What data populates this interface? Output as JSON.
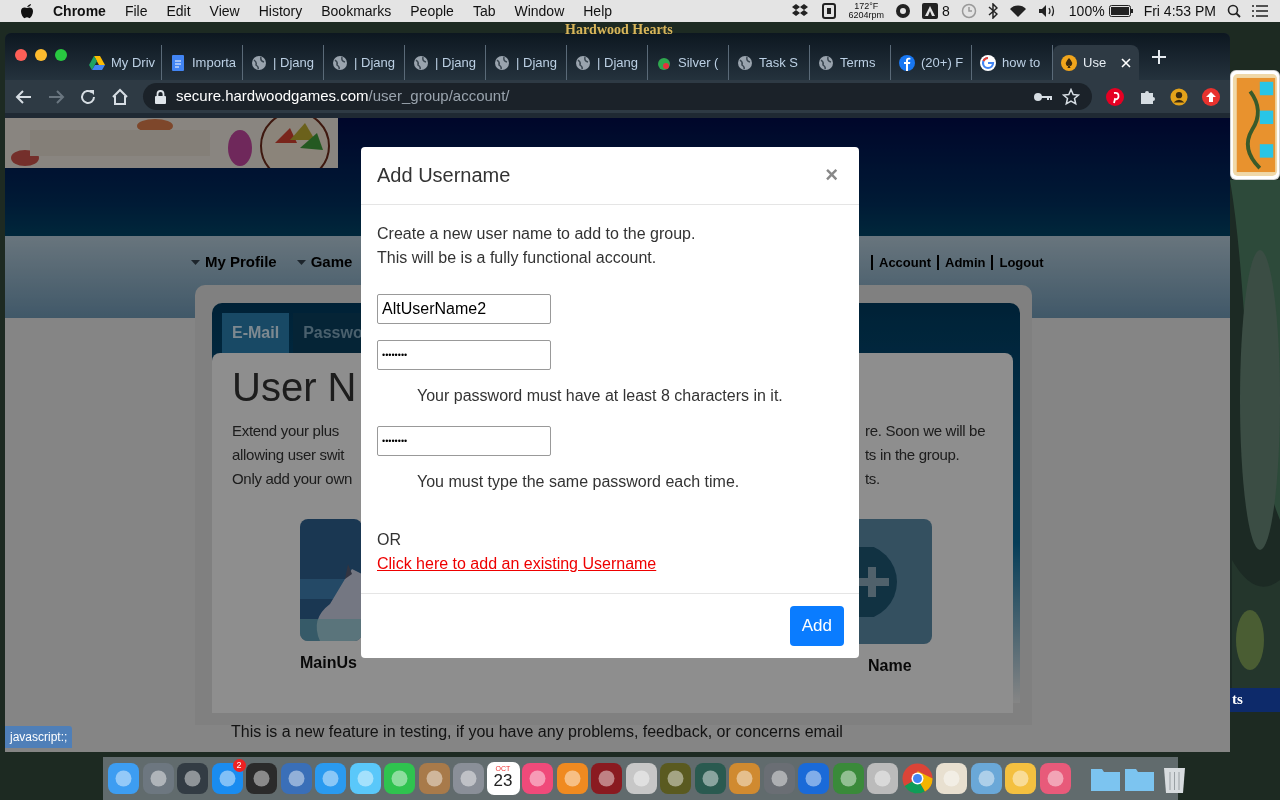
{
  "menu_bar": {
    "app": "Chrome",
    "menus": [
      "File",
      "Edit",
      "View",
      "History",
      "Bookmarks",
      "People",
      "Tab",
      "Window",
      "Help"
    ],
    "status": {
      "temperature": "172°F",
      "fan": "6204rpm",
      "adobe_count": "8",
      "battery": "100%",
      "clock": "Fri 4:53 PM"
    }
  },
  "background_window": {
    "title": "Hardwood Hearts"
  },
  "browser": {
    "tabs": [
      {
        "label": "My Driv",
        "kind": "drive",
        "selected": false
      },
      {
        "label": "Importa",
        "kind": "docs",
        "selected": false
      },
      {
        "label": "| Djang",
        "kind": "globe",
        "selected": false
      },
      {
        "label": "| Djang",
        "kind": "globe",
        "selected": false
      },
      {
        "label": "| Djang",
        "kind": "globe",
        "selected": false
      },
      {
        "label": "| Djang",
        "kind": "globe",
        "selected": false
      },
      {
        "label": "| Djang",
        "kind": "globe",
        "selected": false
      },
      {
        "label": "Silver (",
        "kind": "shield",
        "selected": false
      },
      {
        "label": "Task S",
        "kind": "globe",
        "selected": false
      },
      {
        "label": "Terms",
        "kind": "globe",
        "selected": false
      },
      {
        "label": "(20+) F",
        "kind": "facebook",
        "selected": false
      },
      {
        "label": "how to",
        "kind": "google",
        "selected": false
      },
      {
        "label": "Use",
        "kind": "site",
        "selected": true
      }
    ],
    "url_host": "secure.hardwoodgames.com",
    "url_path": "/user_group/account/"
  },
  "page": {
    "nav_left": [
      "My Profile",
      "Game"
    ],
    "nav_right": [
      "Account",
      "Admin",
      "Logout"
    ],
    "tabs": [
      {
        "label": "E-Mail",
        "selected": true
      },
      {
        "label": "Passwo",
        "selected": false
      }
    ],
    "heading": "User N",
    "intro_left": [
      "Extend your plus",
      "allowing user swit",
      "Only add your own"
    ],
    "intro_right": [
      "re. Soon we will be",
      "ts in the group.",
      "ts."
    ],
    "users": [
      {
        "kind": "avatar",
        "label": "MainUs"
      },
      {
        "kind": "add",
        "label": "Name"
      }
    ],
    "footer": "This is a new feature in testing, if you have any problems, feedback, or concerns email"
  },
  "modal": {
    "title": "Add Username",
    "close": "×",
    "intro": [
      "Create a new user name to add to the group.",
      "This will be is a fully functional account."
    ],
    "fields": [
      {
        "kind": "text",
        "value": "AltUserName2"
      },
      {
        "kind": "password",
        "value": "••••••••",
        "help": "Your password must have at least 8 characters in it."
      },
      {
        "kind": "password",
        "value": "••••••••",
        "help": "You must type the same password each time."
      }
    ],
    "or": "OR",
    "link": "Click here to add an existing Username",
    "button": "Add"
  },
  "status_link": "javascript:;",
  "side_window_text": "ts",
  "dock": {
    "badge": "2",
    "calendar_month": "OCT",
    "calendar_day": "23"
  }
}
